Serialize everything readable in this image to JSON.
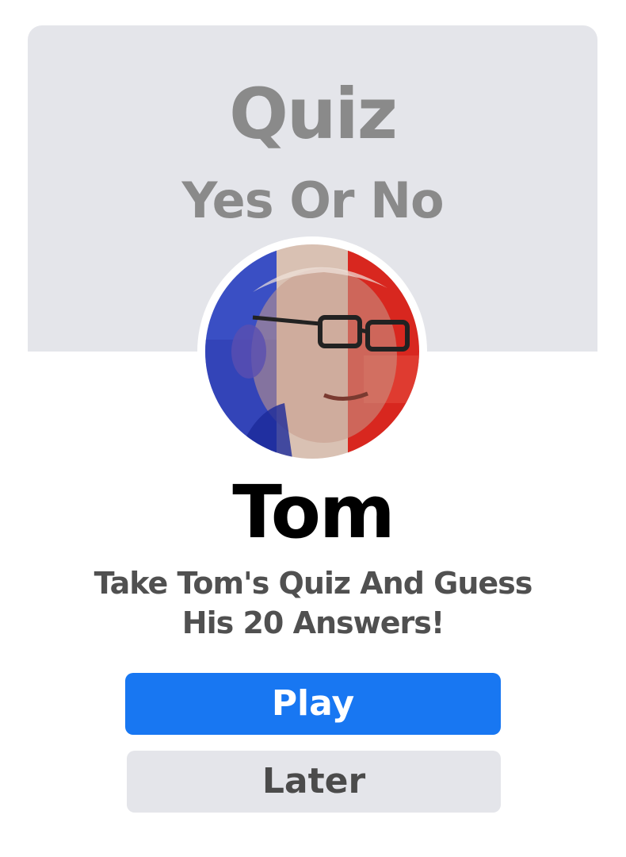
{
  "header": {
    "title": "Quiz",
    "subtitle": "Yes Or No"
  },
  "profile": {
    "name": "Tom",
    "avatar_overlay": "french-flag",
    "flag_colors": [
      "#3246c8",
      "#e8c7b5",
      "#d8231e"
    ]
  },
  "invite": {
    "line1": "Take Tom's Quiz And Guess",
    "line2": "His 20 Answers!"
  },
  "actions": {
    "play_label": "Play",
    "later_label": "Later"
  },
  "colors": {
    "primary": "#1877f2",
    "secondary_bg": "#e4e5ea",
    "title_gray": "#8a8a8a"
  }
}
